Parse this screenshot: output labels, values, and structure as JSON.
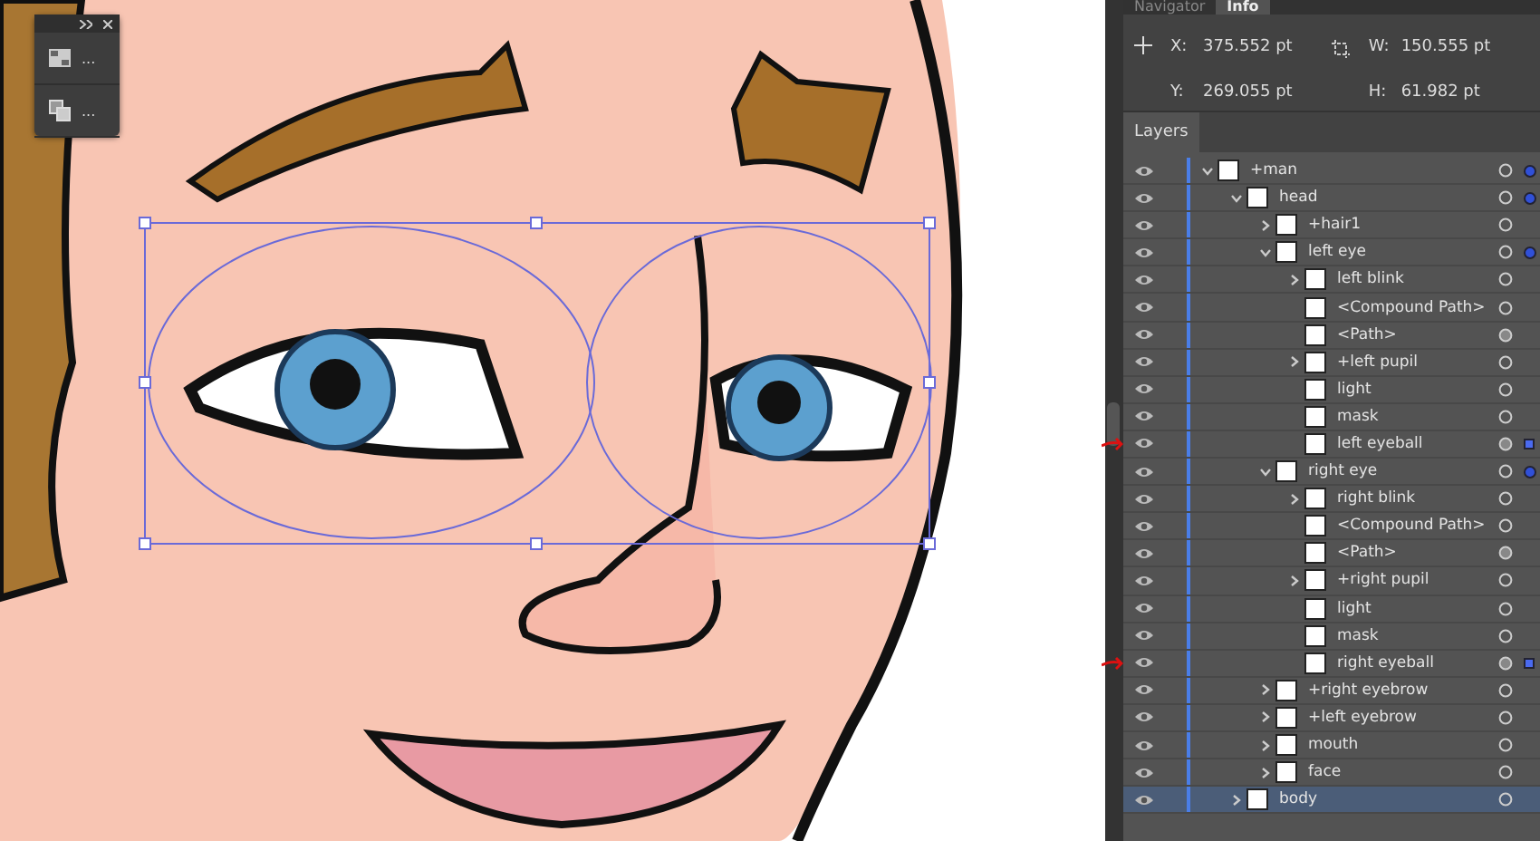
{
  "float_panel": {
    "tools": [
      {
        "kind": "grid",
        "more": "..."
      },
      {
        "kind": "arrange",
        "more": "..."
      }
    ]
  },
  "info_panel": {
    "tabs": [
      {
        "label": "Navigator",
        "selected": false
      },
      {
        "label": "Info",
        "selected": true
      }
    ],
    "x_label": "X:",
    "x_value": "375.552 pt",
    "y_label": "Y:",
    "y_value": "269.055 pt",
    "w_label": "W:",
    "w_value": "150.555 pt",
    "h_label": "H:",
    "h_value": "61.982 pt"
  },
  "layers_panel": {
    "tab": "Layers",
    "layers": [
      {
        "name": "+man",
        "kind": "group",
        "expanded": true,
        "contains_selection": true,
        "selected": false,
        "children": [
          {
            "name": "head",
            "kind": "group",
            "expanded": true,
            "contains_selection": true,
            "selected": false,
            "children": [
              {
                "name": "+hair1",
                "kind": "group",
                "expanded": false,
                "contains_selection": false,
                "selected": false
              },
              {
                "name": "left eye",
                "kind": "group",
                "expanded": true,
                "contains_selection": true,
                "selected": false,
                "children": [
                  {
                    "name": "left blink",
                    "kind": "group",
                    "expanded": false,
                    "contains_selection": false,
                    "selected": false
                  },
                  {
                    "name": "<Compound Path>",
                    "kind": "object",
                    "art_selected": false,
                    "appearance": false,
                    "selected": false
                  },
                  {
                    "name": "<Path>",
                    "kind": "object",
                    "art_selected": false,
                    "appearance": true,
                    "selected": false
                  },
                  {
                    "name": "+left pupil",
                    "kind": "group",
                    "expanded": false,
                    "contains_selection": false,
                    "selected": false
                  },
                  {
                    "name": "light",
                    "kind": "object",
                    "art_selected": false,
                    "appearance": false,
                    "selected": false
                  },
                  {
                    "name": "mask",
                    "kind": "object",
                    "art_selected": false,
                    "appearance": false,
                    "selected": false
                  },
                  {
                    "name": "left eyeball",
                    "kind": "object",
                    "art_selected": true,
                    "appearance": true,
                    "selected": false,
                    "annotated": true
                  }
                ]
              },
              {
                "name": "right eye",
                "kind": "group",
                "expanded": true,
                "contains_selection": true,
                "selected": false,
                "children": [
                  {
                    "name": "right blink",
                    "kind": "group",
                    "expanded": false,
                    "contains_selection": false,
                    "selected": false
                  },
                  {
                    "name": "<Compound Path>",
                    "kind": "object",
                    "art_selected": false,
                    "appearance": false,
                    "selected": false
                  },
                  {
                    "name": "<Path>",
                    "kind": "object",
                    "art_selected": false,
                    "appearance": true,
                    "selected": false
                  },
                  {
                    "name": "+right pupil",
                    "kind": "group",
                    "expanded": false,
                    "contains_selection": false,
                    "selected": false
                  },
                  {
                    "name": "light",
                    "kind": "object",
                    "art_selected": false,
                    "appearance": false,
                    "selected": false
                  },
                  {
                    "name": "mask",
                    "kind": "object",
                    "art_selected": false,
                    "appearance": false,
                    "selected": false
                  },
                  {
                    "name": "right eyeball",
                    "kind": "object",
                    "art_selected": true,
                    "appearance": true,
                    "selected": false,
                    "annotated": true
                  }
                ]
              },
              {
                "name": "+right eyebrow",
                "kind": "group",
                "expanded": false,
                "contains_selection": false,
                "selected": false
              },
              {
                "name": "+left eyebrow",
                "kind": "group",
                "expanded": false,
                "contains_selection": false,
                "selected": false
              },
              {
                "name": "mouth",
                "kind": "group",
                "expanded": false,
                "contains_selection": false,
                "selected": false
              },
              {
                "name": "face",
                "kind": "group",
                "expanded": false,
                "contains_selection": false,
                "selected": false
              }
            ]
          },
          {
            "name": "body",
            "kind": "group",
            "expanded": false,
            "contains_selection": false,
            "selected": true
          }
        ]
      }
    ]
  }
}
